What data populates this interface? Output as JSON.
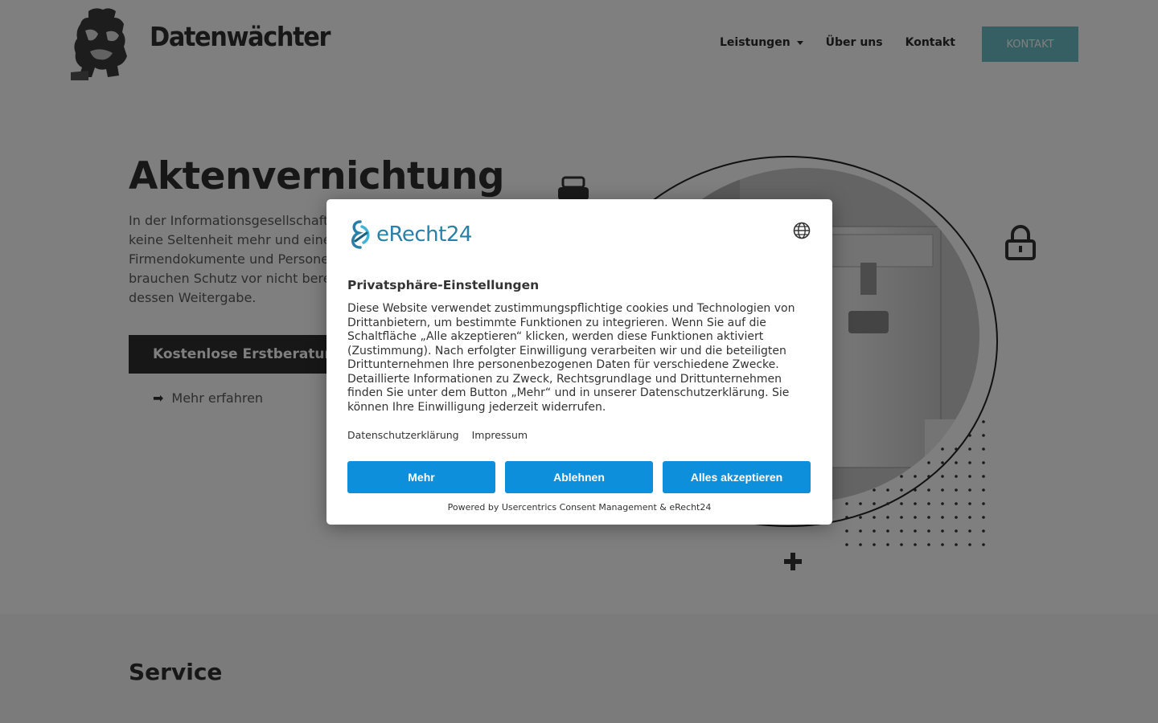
{
  "header": {
    "brand": "Datenwächter",
    "nav": [
      {
        "label": "Leistungen",
        "has_dropdown": true
      },
      {
        "label": "Über uns"
      },
      {
        "label": "Kontakt"
      }
    ],
    "cta_label": "KONTAKT"
  },
  "hero": {
    "title": "Aktenvernichtung",
    "text_lines": [
      "In der Informationsgesellschaft",
      "keine Seltenheit mehr und eine",
      "Firmendokumente und Persone",
      "brauchen Schutz vor nicht bere",
      "dessen Weitergabe."
    ],
    "cta_label": "Kostenlose Erstberatung",
    "more_label": "Mehr erfahren"
  },
  "service": {
    "title": "Service"
  },
  "consent": {
    "logo_text": "eRecht24",
    "title": "Privatsphäre-Einstellungen",
    "description": "Diese Website verwendet zustimmungspflichtige cookies und Technologien von Drittanbietern, um bestimmte Funktionen zu integrieren. Wenn Sie auf die Schaltfläche „Alle akzeptieren“ klicken, werden diese Funktionen aktiviert (Zustimmung). Nach erfolgter Einwilligung verarbeiten wir und die beteiligten Drittunternehmen Ihre personenbezogenen Daten für verschiedene Zwecke. Detaillierte Informationen zu Zweck, Rechtsgrundlage und Drittunternehmen finden Sie unter dem Button „Mehr“ und in unserer Datenschutzerklärung. Sie können Ihre Einwilligung jederzeit widerrufen.",
    "links": [
      "Datenschutzerklärung",
      "Impressum"
    ],
    "buttons": {
      "more": "Mehr",
      "deny": "Ablehnen",
      "accept": "Alles akzeptieren"
    },
    "footer": "Powered by Usercentrics Consent Management & eRecht24"
  },
  "colors": {
    "accent": "#6bbfc5",
    "dark_button": "#2f2f2f",
    "consent_button": "#0e8fdb",
    "erecht_blue": "#2a7fa8",
    "overlay": "rgba(0,0,0,0.5)"
  },
  "icons": [
    "bull-logo",
    "printer-icon",
    "lock-icon",
    "plus-icon",
    "globe-icon",
    "arrow-right-icon",
    "caret-down-icon",
    "erecht24-logo"
  ]
}
